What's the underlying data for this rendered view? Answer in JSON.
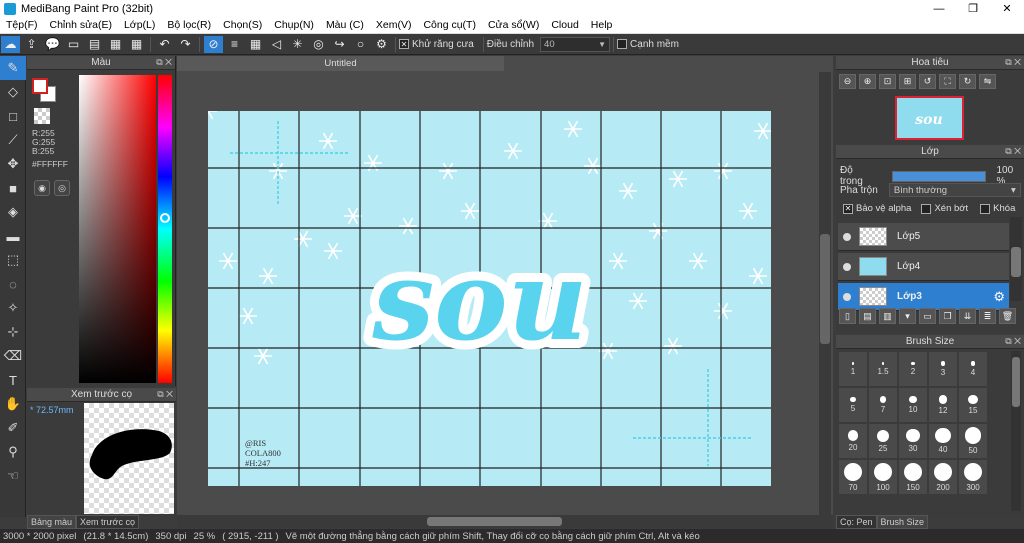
{
  "window": {
    "title": "MediBang Paint Pro (32bit)",
    "min": "—",
    "max": "❐",
    "close": "✕"
  },
  "menu": [
    "Tệp(F)",
    "Chỉnh sửa(E)",
    "Lớp(L)",
    "Bộ lọc(R)",
    "Chọn(S)",
    "Chụp(N)",
    "Màu (C)",
    "Xem(V)",
    "Công cụ(T)",
    "Cửa sổ(W)",
    "Cloud",
    "Help"
  ],
  "toolbar": {
    "antialias_label": "Khử răng cưa",
    "adjust_label": "Điều chỉnh",
    "adjust_value": "40",
    "edge_label": "Cạnh mềm",
    "checked": "✕"
  },
  "color_panel": {
    "title": "Màu",
    "r": "R:255",
    "g": "G:255",
    "b": "B:255",
    "hex": "#FFFFFF"
  },
  "brush_preview": {
    "title": "Xem trước cọ",
    "size": "* 72.57mm"
  },
  "left_tabs": [
    "Bảng màu",
    "Xem trước cọ"
  ],
  "document": {
    "tab": "Untitled"
  },
  "canvas_art": {
    "logo_text": "sou",
    "credit": [
      "@RIS",
      "COLA800",
      "#H:247"
    ],
    "bg_color": "#b6ebf5",
    "logo_color": "#5ad3ee"
  },
  "navigator": {
    "title": "Hoa tiêu",
    "thumb_text": "sou"
  },
  "layer_panel": {
    "title": "Lớp",
    "opacity_label": "Độ trong",
    "opacity_value": "100 %",
    "opacity_fraction": 1.0,
    "blend_label": "Pha trộn",
    "blend_value": "Bình thường",
    "protect_alpha": "Bảo vệ alpha",
    "clipping": "Xén bớt",
    "lock": "Khóa",
    "layers": [
      {
        "name": "Lớp5",
        "selected": false
      },
      {
        "name": "Lớp4",
        "selected": false
      },
      {
        "name": "Lớp3",
        "selected": true
      }
    ]
  },
  "brush_size": {
    "title": "Brush Size",
    "sizes": [
      "1",
      "1.5",
      "2",
      "3",
      "4",
      "5",
      "7",
      "10",
      "12",
      "15",
      "20",
      "25",
      "30",
      "40",
      "50",
      "70",
      "100",
      "150",
      "200",
      "300"
    ]
  },
  "right_tabs": [
    "Cọ: Pen",
    "Brush Size"
  ],
  "status": {
    "pixels": "3000 * 2000 pixel",
    "physical": "(21.8 * 14.5cm)",
    "dpi": "350 dpi",
    "zoom": "25 %",
    "coords": "( 2915, -211 )",
    "hint": "Vẽ một đường thẳng bằng cách giữ phím Shift, Thay đổi cỡ cọ bằng cách giữ phím Ctrl, Alt và kéo"
  }
}
